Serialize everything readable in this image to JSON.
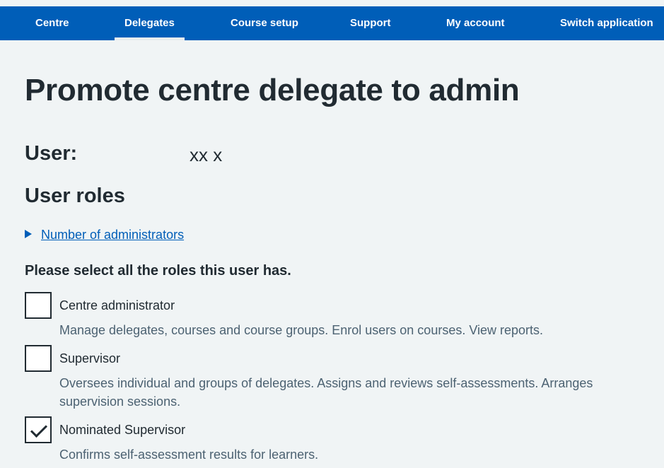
{
  "nav": {
    "items": [
      {
        "label": "Centre"
      },
      {
        "label": "Delegates",
        "active": true
      },
      {
        "label": "Course setup"
      },
      {
        "label": "Support"
      },
      {
        "label": "My account"
      },
      {
        "label": "Switch application"
      }
    ]
  },
  "page": {
    "title": "Promote centre delegate to admin",
    "user_label": "User:",
    "user_value": "xx x",
    "roles_heading": "User roles",
    "details_summary": "Number of administrators",
    "legend": "Please select all the roles this user has."
  },
  "roles": [
    {
      "label": "Centre administrator",
      "hint": "Manage delegates, courses and course groups. Enrol users on courses. View reports.",
      "checked": false
    },
    {
      "label": "Supervisor",
      "hint": "Oversees individual and groups of delegates. Assigns and reviews self-assessments. Arranges supervision sessions.",
      "checked": false
    },
    {
      "label": "Nominated Supervisor",
      "hint": "Confirms self-assessment results for learners.",
      "checked": true
    }
  ],
  "colors": {
    "nav_bg": "#005eb8",
    "page_bg": "#f0f4f5",
    "text": "#212b32",
    "hint": "#4c6272",
    "link": "#005eb8"
  }
}
